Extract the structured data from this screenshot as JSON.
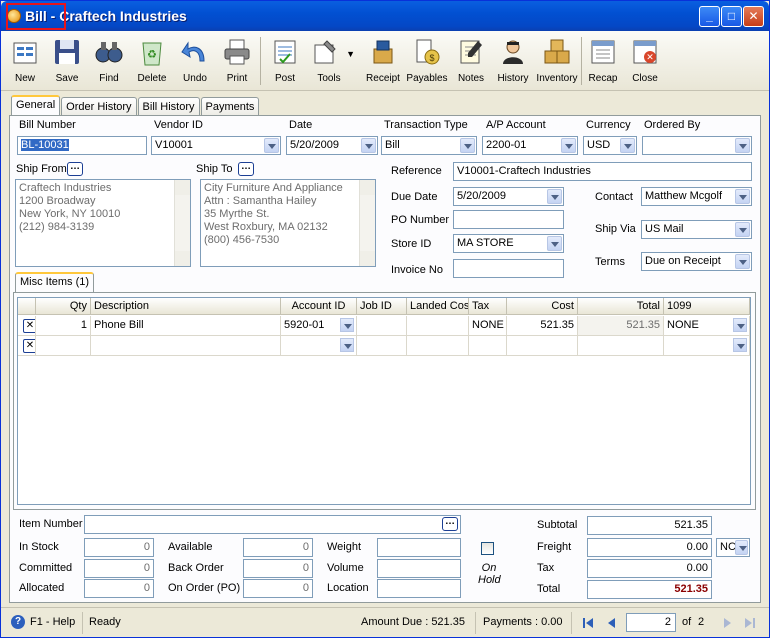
{
  "window": {
    "title": "Bill - Craftech Industries"
  },
  "toolbar": [
    {
      "id": "new",
      "label": "New"
    },
    {
      "id": "save",
      "label": "Save"
    },
    {
      "id": "find",
      "label": "Find"
    },
    {
      "id": "delete",
      "label": "Delete"
    },
    {
      "id": "undo",
      "label": "Undo"
    },
    {
      "id": "print",
      "label": "Print"
    },
    {
      "id": "post",
      "label": "Post"
    },
    {
      "id": "tools",
      "label": "Tools"
    },
    {
      "id": "receipt",
      "label": "Receipt"
    },
    {
      "id": "payables",
      "label": "Payables"
    },
    {
      "id": "notes",
      "label": "Notes"
    },
    {
      "id": "history",
      "label": "History"
    },
    {
      "id": "inventory",
      "label": "Inventory"
    },
    {
      "id": "recap",
      "label": "Recap"
    },
    {
      "id": "close",
      "label": "Close"
    }
  ],
  "tabs": [
    "General",
    "Order History",
    "Bill History",
    "Payments"
  ],
  "header": {
    "bill_number_label": "Bill Number",
    "bill_number": "BL-10031",
    "vendor_id_label": "Vendor ID",
    "vendor_id": "V10001",
    "date_label": "Date",
    "date": "5/20/2009",
    "transaction_type_label": "Transaction Type",
    "transaction_type": "Bill",
    "ap_account_label": "A/P Account",
    "ap_account": "2200-01",
    "currency_label": "Currency",
    "currency": "USD",
    "ordered_by_label": "Ordered By",
    "ordered_by": ""
  },
  "ship_from": {
    "label": "Ship From",
    "lines": [
      "Craftech Industries",
      "1200 Broadway",
      "New York, NY 10010",
      "(212) 984-3139"
    ]
  },
  "ship_to": {
    "label": "Ship To",
    "lines": [
      "City Furniture And Appliance",
      "Attn : Samantha Hailey",
      "35 Myrthe St.",
      "West Roxbury, MA 02132",
      "(800) 456-7530"
    ]
  },
  "details": {
    "reference_label": "Reference",
    "reference": "V10001-Craftech Industries",
    "due_date_label": "Due Date",
    "due_date": "5/20/2009",
    "po_number_label": "PO Number",
    "po_number": "",
    "store_id_label": "Store ID",
    "store_id": "MA STORE",
    "invoice_no_label": "Invoice No",
    "invoice_no": "",
    "contact_label": "Contact",
    "contact": "Matthew Mcgolf",
    "ship_via_label": "Ship Via",
    "ship_via": "US Mail",
    "terms_label": "Terms",
    "terms": "Due on Receipt"
  },
  "items_tab": "Misc Items (1)",
  "grid": {
    "columns": [
      "Qty",
      "Description",
      "Account ID",
      "Job ID",
      "Landed Cos",
      "Tax",
      "Cost",
      "Total",
      "1099"
    ],
    "rows": [
      {
        "qty": "1",
        "description": "Phone Bill",
        "account_id": "5920-01",
        "job_id": "",
        "landed_cost": "",
        "tax": "NONE",
        "cost": "521.35",
        "total": "521.35",
        "f1099": "NONE"
      },
      {
        "qty": "",
        "description": "",
        "account_id": "",
        "job_id": "",
        "landed_cost": "",
        "tax": "",
        "cost": "",
        "total": "",
        "f1099": ""
      }
    ]
  },
  "footer": {
    "item_number_label": "Item Number",
    "item_number": "",
    "in_stock_label": "In Stock",
    "in_stock": "0",
    "committed_label": "Committed",
    "committed": "0",
    "allocated_label": "Allocated",
    "allocated": "0",
    "available_label": "Available",
    "available": "0",
    "back_order_label": "Back Order",
    "back_order": "0",
    "on_order_label": "On Order (PO)",
    "on_order": "0",
    "weight_label": "Weight",
    "weight": "",
    "volume_label": "Volume",
    "volume": "",
    "location_label": "Location",
    "location": "",
    "on_hold_label": "On Hold",
    "subtotal_label": "Subtotal",
    "subtotal": "521.35",
    "freight_label": "Freight",
    "freight": "0.00",
    "freight_code": "NC",
    "tax_label": "Tax",
    "tax": "0.00",
    "total_label": "Total",
    "total": "521.35"
  },
  "status": {
    "help": "F1 - Help",
    "state": "Ready",
    "amount_due": "Amount Due : 521.35",
    "payments": "Payments : 0.00",
    "page": "2",
    "of_label": "of",
    "page_count": "2"
  },
  "colors": {
    "title_bar": "#0250d2",
    "total_text": "#8b0000",
    "highlight": "#e8141b"
  }
}
